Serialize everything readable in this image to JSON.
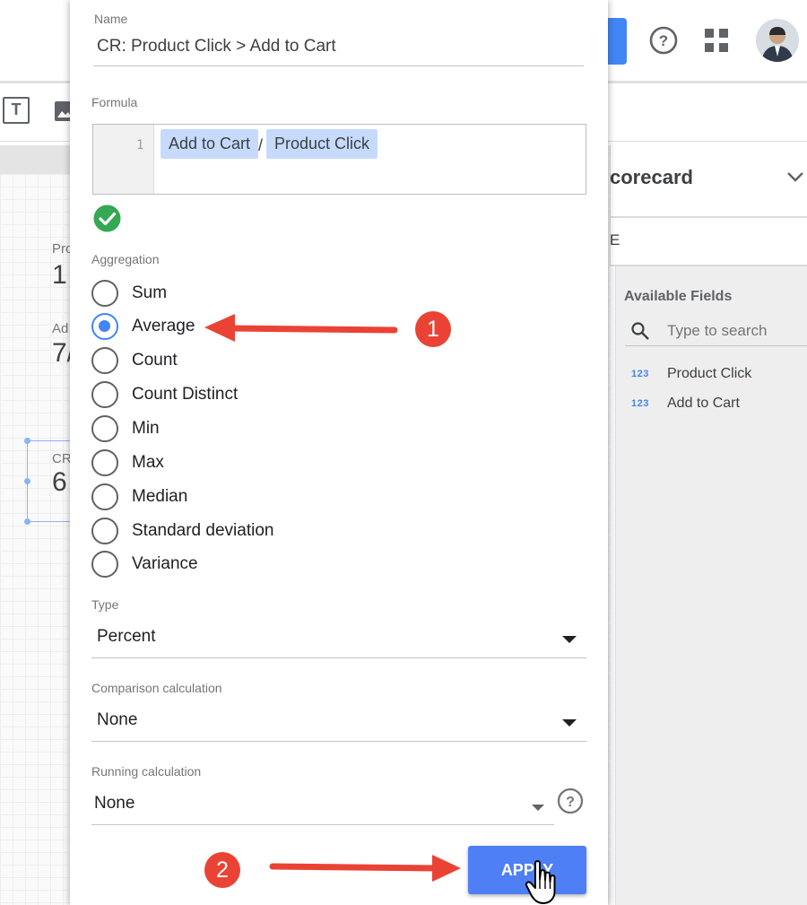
{
  "colors": {
    "accent": "#4285f4",
    "apply_button": "#4f7ff5",
    "chip": "#c6dafc",
    "annotation": "#ea4335",
    "valid": "#34a853"
  },
  "background": {
    "canvas_cards": [
      {
        "label": "Pro",
        "value": "1"
      },
      {
        "label": "Ad",
        "value": "7/"
      },
      {
        "label": "CR",
        "value": "6"
      }
    ],
    "right_panel": {
      "title": "corecard",
      "tab_label": "E",
      "available_fields_title": "Available Fields",
      "search_placeholder": "Type to search",
      "fields": [
        {
          "type_icon": "123",
          "name": "Product Click"
        },
        {
          "type_icon": "123",
          "name": "Add to Cart"
        }
      ]
    }
  },
  "dialog": {
    "name_label": "Name",
    "name_value": "CR: Product Click > Add to Cart",
    "formula_label": "Formula",
    "formula": {
      "line_number": "1",
      "left_field": "Add to Cart",
      "operator": "/",
      "right_field": "Product Click"
    },
    "aggregation_label": "Aggregation",
    "aggregation_options": [
      "Sum",
      "Average",
      "Count",
      "Count Distinct",
      "Min",
      "Max",
      "Median",
      "Standard deviation",
      "Variance"
    ],
    "aggregation_selected": "Average",
    "type_label": "Type",
    "type_value": "Percent",
    "comparison_label": "Comparison calculation",
    "comparison_value": "None",
    "running_label": "Running calculation",
    "running_value": "None",
    "apply_label": "APPLY"
  },
  "annotations": {
    "step1": "1",
    "step2": "2"
  }
}
